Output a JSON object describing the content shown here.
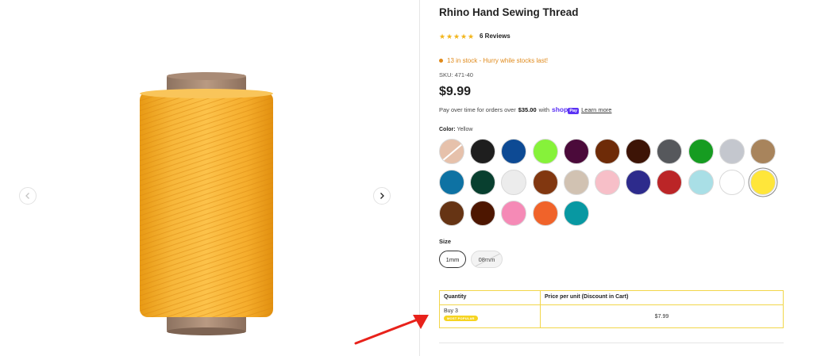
{
  "product": {
    "title": "Rhino Hand Sewing Thread",
    "rating_stars": 5,
    "reviews": "6 Reviews",
    "stock": "13 in stock - Hurry while stocks last!",
    "sku": "SKU: 471-40",
    "price": "$9.99",
    "payline": {
      "prefix": "Pay over time for orders over",
      "amount": "$35.00",
      "with": "with",
      "shop": "shop",
      "pay": "Pay",
      "learn": "Learn more"
    }
  },
  "gallery": {
    "prev_icon": "chevron-left-icon",
    "next_icon": "chevron-right-icon",
    "image": "yellow-thread-spool"
  },
  "color": {
    "label": "Color:",
    "selected": "Yellow",
    "swatches": [
      {
        "hex": "#e6c1ab",
        "unavailable": true
      },
      {
        "hex": "#1e1e1e"
      },
      {
        "hex": "#0d4a94"
      },
      {
        "hex": "#86f23a"
      },
      {
        "hex": "#4b0a3a"
      },
      {
        "hex": "#6e2b08"
      },
      {
        "hex": "#3d1406"
      },
      {
        "hex": "#56585c"
      },
      {
        "hex": "#169c21"
      },
      {
        "hex": "#c4c7ce"
      },
      {
        "hex": "#a8845c"
      },
      {
        "hex": "#0e72a3"
      },
      {
        "hex": "#083f2f"
      },
      {
        "hex": "#ececec"
      },
      {
        "hex": "#813710"
      },
      {
        "hex": "#d1c2b2"
      },
      {
        "hex": "#f7bfc8"
      },
      {
        "hex": "#2d2b8c"
      },
      {
        "hex": "#bb2527"
      },
      {
        "hex": "#a9dfe6"
      },
      {
        "hex": "#ffffff"
      },
      {
        "hex": "#ffe63a",
        "selected": true
      },
      {
        "hex": "#663414"
      },
      {
        "hex": "#4d1600"
      },
      {
        "hex": "#f58ab6"
      },
      {
        "hex": "#f0632a"
      },
      {
        "hex": "#0898a2"
      }
    ]
  },
  "size": {
    "label": "Size",
    "options": [
      {
        "label": "1mm",
        "selected": true
      },
      {
        "label": "08mm",
        "unavailable": true
      }
    ]
  },
  "discount_table": {
    "headers": [
      "Quantity",
      "Price per unit (Discount in Cart)"
    ],
    "rows": [
      {
        "quantity": "Buy 3",
        "badge": "MOST POPULAR",
        "price": "$7.99"
      }
    ]
  },
  "colors": {
    "accent_orange": "#e08a1b",
    "shop_purple": "#5a31f4",
    "table_border": "#f2d64a",
    "annotation_arrow": "#e8221b"
  }
}
